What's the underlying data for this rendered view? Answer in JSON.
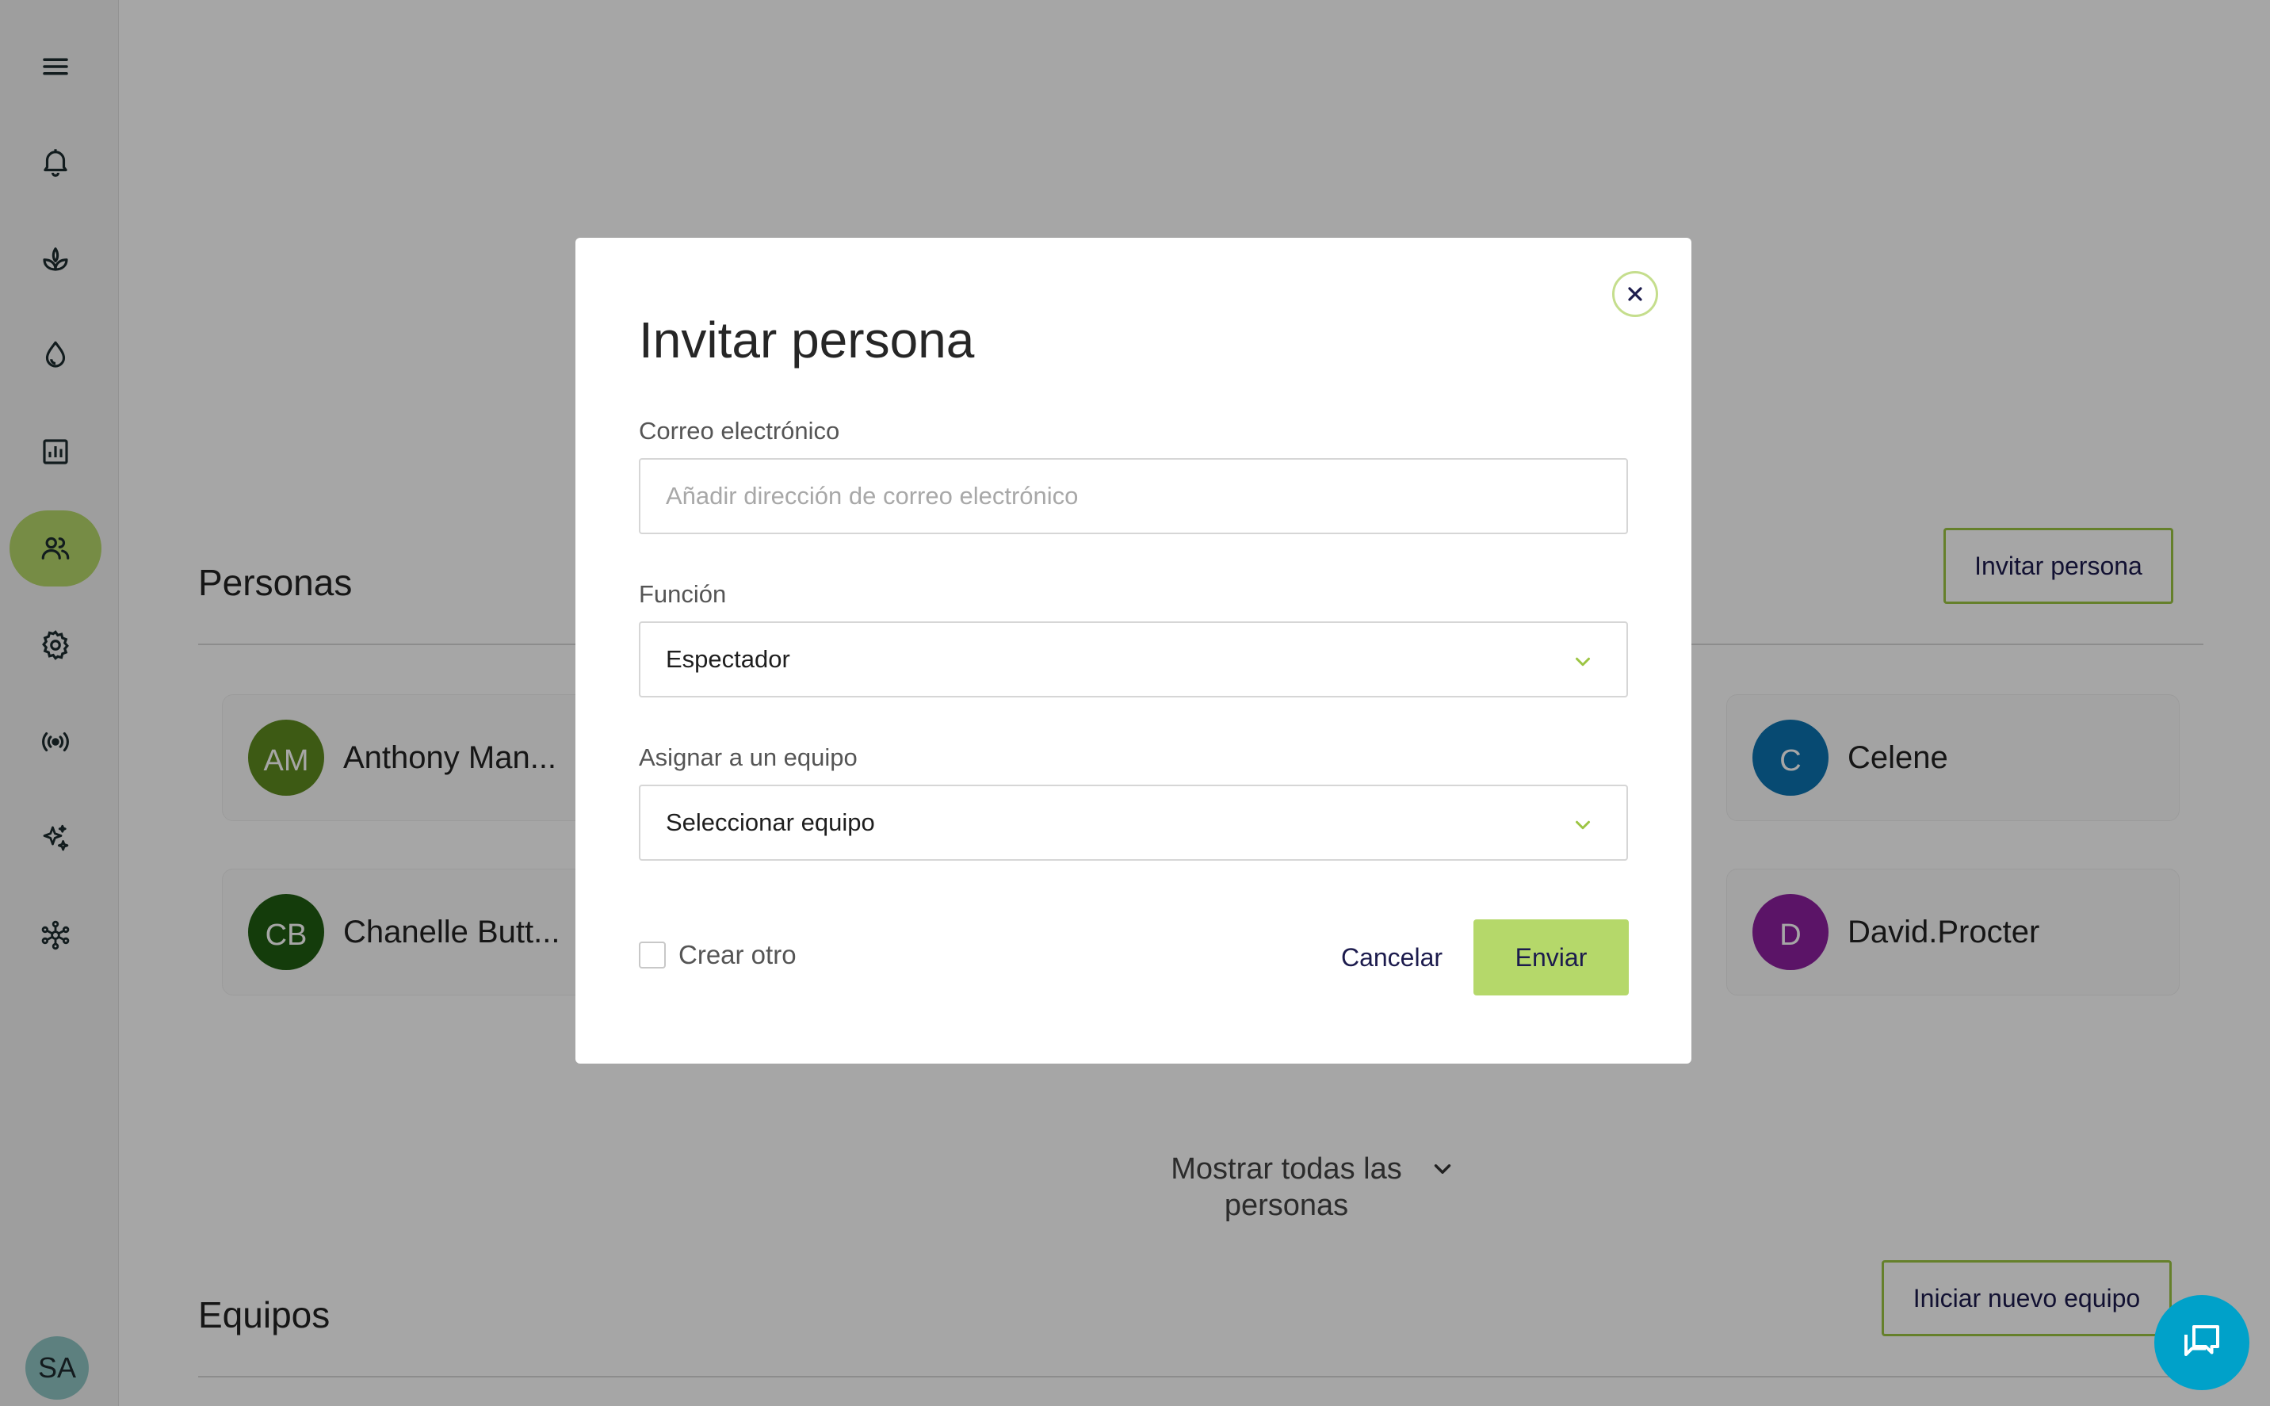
{
  "sidebar": {
    "items": [
      {
        "icon": "menu-icon"
      },
      {
        "icon": "bell-icon"
      },
      {
        "icon": "plant-icon"
      },
      {
        "icon": "water-drop-icon"
      },
      {
        "icon": "chart-icon"
      },
      {
        "icon": "people-icon",
        "active": true
      },
      {
        "icon": "gear-icon"
      },
      {
        "icon": "broadcast-icon"
      },
      {
        "icon": "sparkles-icon"
      },
      {
        "icon": "network-icon"
      }
    ],
    "user_initials": "SA"
  },
  "people_section": {
    "title": "Personas",
    "invite_button": "Invitar persona",
    "people": [
      {
        "initials": "AM",
        "name": "Anthony Man...",
        "color": "#5f8a1f"
      },
      {
        "initials": "C",
        "name": "Celene",
        "color": "#0b72b0"
      },
      {
        "initials": "CB",
        "name": "Chanelle Butt...",
        "color": "#1f5d12"
      },
      {
        "initials": "D",
        "name": "David.Procter",
        "color": "#8c1f9e"
      }
    ],
    "show_all": "Mostrar todas las personas"
  },
  "teams_section": {
    "title": "Equipos",
    "new_team_button": "Iniciar nuevo equipo"
  },
  "modal": {
    "title": "Invitar persona",
    "email_label": "Correo electrónico",
    "email_placeholder": "Añadir dirección de correo electrónico",
    "role_label": "Función",
    "role_value": "Espectador",
    "team_label": "Asignar a un equipo",
    "team_value": "Seleccionar equipo",
    "create_another": "Crear otro",
    "cancel": "Cancelar",
    "send": "Enviar"
  },
  "colors": {
    "accent": "#b5d86a",
    "button_border": "#9cc543",
    "chat_fab": "#00a1c9",
    "link_text": "#1c1b4d"
  }
}
